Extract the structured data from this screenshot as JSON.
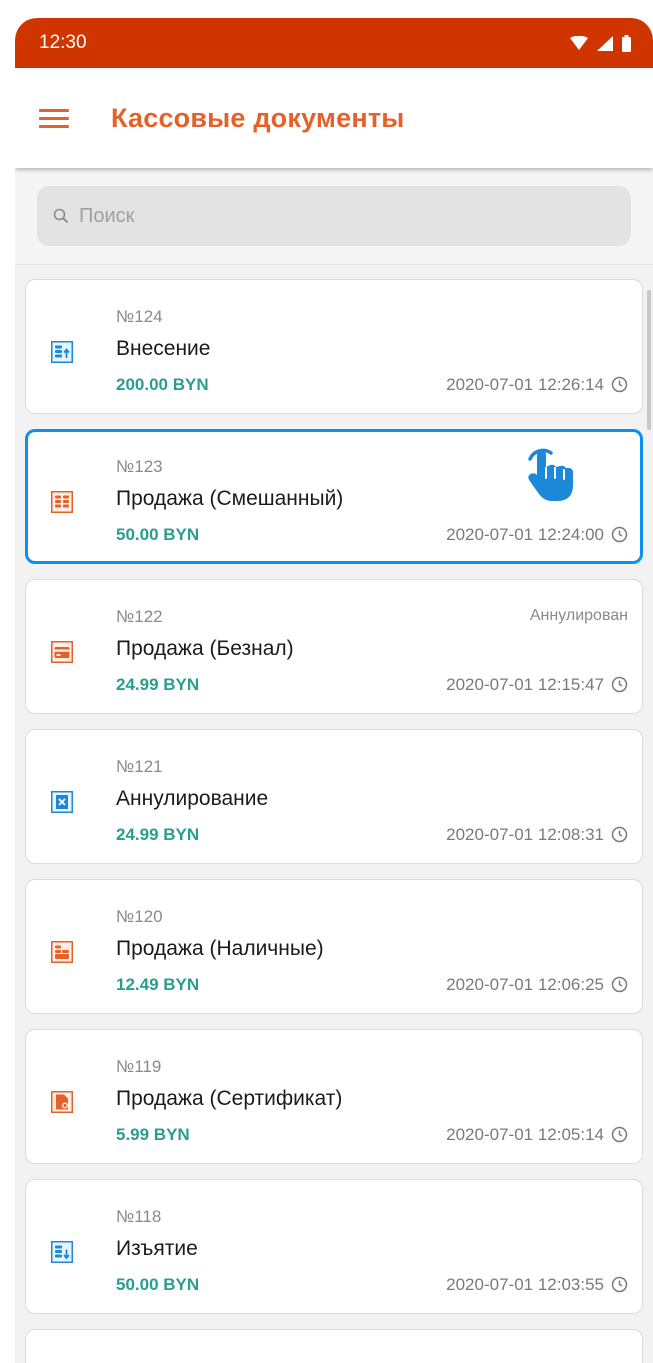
{
  "status_bar": {
    "time": "12:30"
  },
  "app_bar": {
    "title": "Кассовые документы"
  },
  "search": {
    "placeholder": "Поиск"
  },
  "colors": {
    "accent": "#e4622a",
    "status_bar": "#d03500",
    "amount": "#2a9d8f",
    "selection": "#0b8ff0",
    "blue_icon": "#1d88d8"
  },
  "documents": [
    {
      "number": "№124",
      "name": "Внесение",
      "amount": "200.00 BYN",
      "datetime": "2020-07-01 12:26:14",
      "status": "",
      "icon": "cash-in-icon",
      "icon_color": "blue"
    },
    {
      "number": "№123",
      "name": "Продажа (Смешанный)",
      "amount": "50.00 BYN",
      "datetime": "2020-07-01 12:24:00",
      "status": "",
      "icon": "mixed-payment-icon",
      "icon_color": "orange",
      "selected": true
    },
    {
      "number": "№122",
      "name": "Продажа (Безнал)",
      "amount": "24.99 BYN",
      "datetime": "2020-07-01 12:15:47",
      "status": "Аннулирован",
      "icon": "card-payment-icon",
      "icon_color": "orange"
    },
    {
      "number": "№121",
      "name": "Аннулирование",
      "amount": "24.99 BYN",
      "datetime": "2020-07-01 12:08:31",
      "status": "",
      "icon": "cancel-doc-icon",
      "icon_color": "blue"
    },
    {
      "number": "№120",
      "name": "Продажа (Наличные)",
      "amount": "12.49 BYN",
      "datetime": "2020-07-01 12:06:25",
      "status": "",
      "icon": "cash-payment-icon",
      "icon_color": "orange"
    },
    {
      "number": "№119",
      "name": "Продажа (Сертификат)",
      "amount": "5.99 BYN",
      "datetime": "2020-07-01 12:05:14",
      "status": "",
      "icon": "certificate-icon",
      "icon_color": "orange"
    },
    {
      "number": "№118",
      "name": "Изъятие",
      "amount": "50.00 BYN",
      "datetime": "2020-07-01 12:03:55",
      "status": "",
      "icon": "cash-out-icon",
      "icon_color": "blue"
    }
  ]
}
